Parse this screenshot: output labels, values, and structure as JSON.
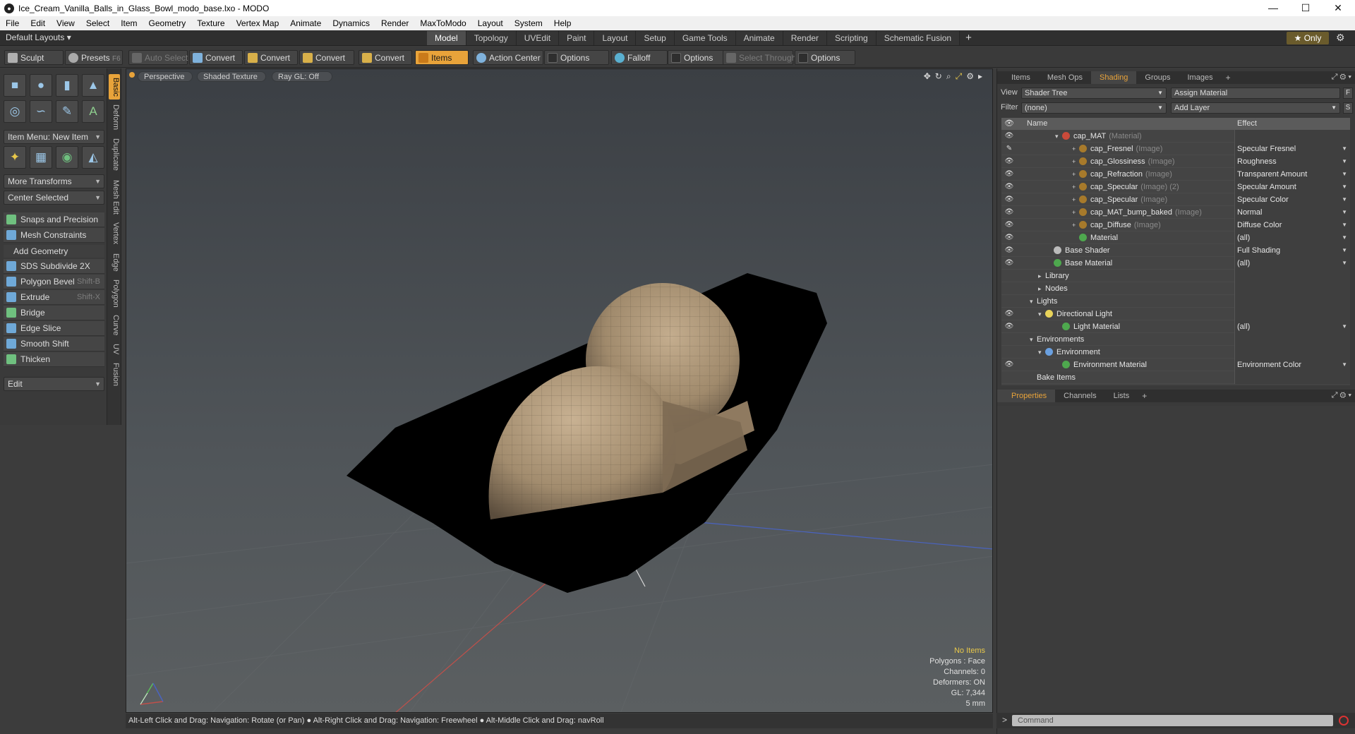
{
  "window": {
    "title": "Ice_Cream_Vanilla_Balls_in_Glass_Bowl_modo_base.lxo - MODO",
    "min": "—",
    "max": "☐",
    "close": "✕"
  },
  "menubar": [
    "File",
    "Edit",
    "View",
    "Select",
    "Item",
    "Geometry",
    "Texture",
    "Vertex Map",
    "Animate",
    "Dynamics",
    "Render",
    "MaxToModo",
    "Layout",
    "System",
    "Help"
  ],
  "layoutbar": {
    "default_layouts": "Default Layouts ▾",
    "tabs": [
      "Model",
      "Topology",
      "UVEdit",
      "Paint",
      "Layout",
      "Setup",
      "Game Tools",
      "Animate",
      "Render",
      "Scripting",
      "Schematic Fusion"
    ],
    "active_tab": "Model",
    "plus": "+",
    "only": "★ Only"
  },
  "toolbar": {
    "sculpt": "Sculpt",
    "presets": "Presets",
    "presets_key": "F6",
    "auto_select": "Auto Select",
    "convert1": "Convert",
    "convert2": "Convert",
    "convert3": "Convert",
    "convert4": "Convert",
    "items": "Items",
    "action_center": "Action Center",
    "options1": "Options",
    "falloff": "Falloff",
    "options2": "Options",
    "select_through": "Select Through",
    "options3": "Options"
  },
  "lefttools": {
    "item_menu": "Item Menu: New Item",
    "more_transforms": "More Transforms",
    "center_selected": "Center Selected",
    "snaps": "Snaps and Precision",
    "mesh_constraints": "Mesh Constraints",
    "add_geometry": "Add Geometry",
    "tools": [
      {
        "label": "SDS Subdivide 2X",
        "shortcut": ""
      },
      {
        "label": "Polygon Bevel",
        "shortcut": "Shift-B"
      },
      {
        "label": "Extrude",
        "shortcut": "Shift-X"
      },
      {
        "label": "Bridge",
        "shortcut": ""
      },
      {
        "label": "Edge Slice",
        "shortcut": ""
      },
      {
        "label": "Smooth Shift",
        "shortcut": ""
      },
      {
        "label": "Thicken",
        "shortcut": ""
      }
    ],
    "edit": "Edit",
    "vtabs": [
      "Basic",
      "Deform",
      "Duplicate",
      "Mesh Edit",
      "Vertex",
      "Edge",
      "Polygon",
      "Curve",
      "UV",
      "Fusion"
    ]
  },
  "viewport": {
    "perspective": "Perspective",
    "shaded": "Shaded Texture",
    "raygl": "Ray GL: Off",
    "stats": {
      "no_items": "No Items",
      "polygons": "Polygons : Face",
      "channels": "Channels: 0",
      "deformers": "Deformers: ON",
      "gl": "GL: 7,344",
      "size": "5 mm"
    }
  },
  "statusbar": "Alt-Left Click and Drag: Navigation: Rotate (or Pan) ● Alt-Right Click and Drag: Navigation: Freewheel ● Alt-Middle Click and Drag: navRoll",
  "shading": {
    "tabs": [
      "Items",
      "Mesh Ops",
      "Shading",
      "Groups",
      "Images"
    ],
    "active_tab": "Shading",
    "plus": "+",
    "view_label": "View",
    "view_value": "Shader Tree",
    "assign_material": "Assign Material",
    "btn_f": "F",
    "filter_label": "Filter",
    "filter_value": "(none)",
    "add_layer": "Add Layer",
    "btn_s": "S",
    "col_name": "Name",
    "col_effect": "Effect",
    "rows": [
      {
        "name": "cap_MAT",
        "type": "(Material)",
        "effect": "",
        "indent": 3,
        "icon": "#c94a3a",
        "eye": "👁",
        "exp": "▾"
      },
      {
        "name": "cap_Fresnel",
        "type": "(Image)",
        "effect": "Specular Fresnel",
        "indent": 5,
        "icon": "#a77a2b",
        "eye": "✎",
        "exp": "+"
      },
      {
        "name": "cap_Glossiness",
        "type": "(Image)",
        "effect": "Roughness",
        "indent": 5,
        "icon": "#a77a2b",
        "eye": "👁",
        "exp": "+"
      },
      {
        "name": "cap_Refraction",
        "type": "(Image)",
        "effect": "Transparent Amount",
        "indent": 5,
        "icon": "#a77a2b",
        "eye": "👁",
        "exp": "+"
      },
      {
        "name": "cap_Specular",
        "type": "(Image) (2)",
        "effect": "Specular Amount",
        "indent": 5,
        "icon": "#a77a2b",
        "eye": "👁",
        "exp": "+"
      },
      {
        "name": "cap_Specular",
        "type": "(Image)",
        "effect": "Specular Color",
        "indent": 5,
        "icon": "#a77a2b",
        "eye": "👁",
        "exp": "+"
      },
      {
        "name": "cap_MAT_bump_baked",
        "type": "(Image)",
        "effect": "Normal",
        "indent": 5,
        "icon": "#a77a2b",
        "eye": "👁",
        "exp": "+"
      },
      {
        "name": "cap_Diffuse",
        "type": "(Image)",
        "effect": "Diffuse Color",
        "indent": 5,
        "icon": "#a77a2b",
        "eye": "👁",
        "exp": "+"
      },
      {
        "name": "Material",
        "type": "",
        "effect": "(all)",
        "indent": 5,
        "icon": "#4ea84e",
        "eye": "👁",
        "exp": ""
      },
      {
        "name": "Base Shader",
        "type": "",
        "effect": "Full Shading",
        "indent": 2,
        "icon": "#bbbbbb",
        "eye": "👁",
        "exp": ""
      },
      {
        "name": "Base Material",
        "type": "",
        "effect": "(all)",
        "indent": 2,
        "icon": "#4ea84e",
        "eye": "👁",
        "exp": ""
      },
      {
        "name": "Library",
        "type": "",
        "effect": "",
        "indent": 1,
        "icon": "",
        "eye": "",
        "exp": "▸"
      },
      {
        "name": "Nodes",
        "type": "",
        "effect": "",
        "indent": 1,
        "icon": "",
        "eye": "",
        "exp": "▸"
      },
      {
        "name": "Lights",
        "type": "",
        "effect": "",
        "indent": 0,
        "icon": "",
        "eye": "",
        "exp": "▾"
      },
      {
        "name": "Directional Light",
        "type": "",
        "effect": "",
        "indent": 1,
        "icon": "#e8d35a",
        "eye": "👁",
        "exp": "▾"
      },
      {
        "name": "Light Material",
        "type": "",
        "effect": "(all)",
        "indent": 3,
        "icon": "#4ea84e",
        "eye": "👁",
        "exp": ""
      },
      {
        "name": "Environments",
        "type": "",
        "effect": "",
        "indent": 0,
        "icon": "",
        "eye": "",
        "exp": "▾"
      },
      {
        "name": "Environment",
        "type": "",
        "effect": "",
        "indent": 1,
        "icon": "#6aa0e0",
        "eye": "",
        "exp": "▾"
      },
      {
        "name": "Environment Material",
        "type": "",
        "effect": "Environment Color",
        "indent": 3,
        "icon": "#4ea84e",
        "eye": "👁",
        "exp": ""
      },
      {
        "name": "Bake Items",
        "type": "",
        "effect": "",
        "indent": 0,
        "icon": "",
        "eye": "",
        "exp": ""
      }
    ]
  },
  "properties": {
    "tabs": [
      "Properties",
      "Channels",
      "Lists"
    ],
    "active_tab": "Properties",
    "plus": "+"
  },
  "command": {
    "placeholder": "Command",
    "prompt": ">"
  }
}
